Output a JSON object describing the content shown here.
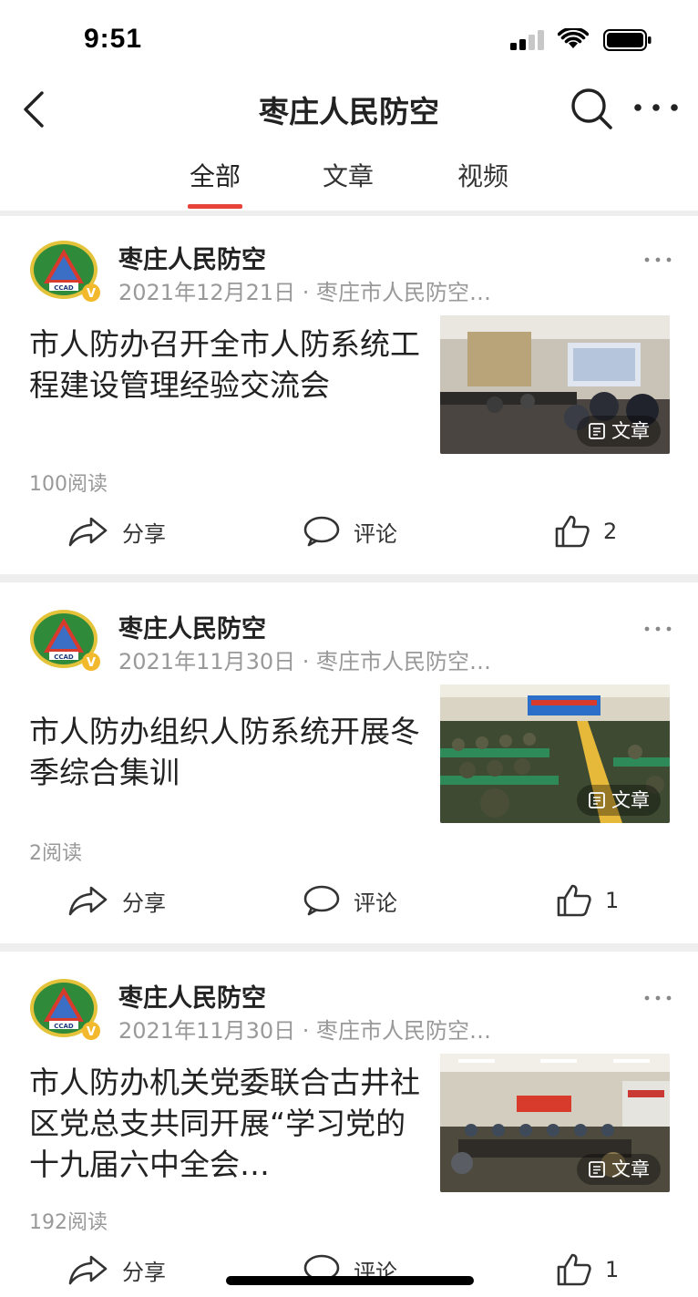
{
  "status_bar": {
    "time": "9:51"
  },
  "nav": {
    "title": "枣庄人民防空"
  },
  "tabs": [
    {
      "label": "全部"
    },
    {
      "label": "文章"
    },
    {
      "label": "视频"
    }
  ],
  "cards": [
    {
      "author": "枣庄人民防空",
      "meta": "2021年12月21日 · 枣庄市人民防空…",
      "headline": "市人防办召开全市人防系统工程建设管理经验交流会",
      "badge": "文章",
      "reads": "100阅读",
      "share": "分享",
      "comment": "评论",
      "likes": "2"
    },
    {
      "author": "枣庄人民防空",
      "meta": "2021年11月30日 · 枣庄市人民防空…",
      "headline": "市人防办组织人防系统开展冬季综合集训",
      "badge": "文章",
      "reads": "2阅读",
      "share": "分享",
      "comment": "评论",
      "likes": "1"
    },
    {
      "author": "枣庄人民防空",
      "meta": "2021年11月30日 · 枣庄市人民防空…",
      "headline": "市人防办机关党委联合古井社区党总支共同开展“学习党的十九届六中全会…",
      "badge": "文章",
      "reads": "192阅读",
      "share": "分享",
      "comment": "评论",
      "likes": "1"
    }
  ],
  "colors": {
    "accent": "#e8433a",
    "muted": "#999999",
    "separator": "#eeeeee"
  },
  "icons": [
    "back-icon",
    "search-icon",
    "more-icon",
    "share-icon",
    "comment-icon",
    "like-icon",
    "article-icon",
    "verified-icon"
  ]
}
